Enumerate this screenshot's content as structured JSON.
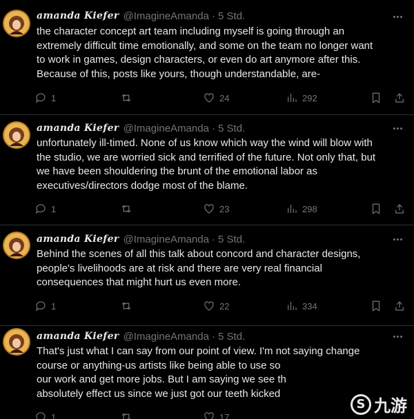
{
  "tweets": [
    {
      "name": "amanda Kiefer",
      "handle": "@ImagineAmanda",
      "sep": "·",
      "time": "5 Std.",
      "lines": [
        "the character concept art team including myself is going through an",
        "extremely difficult time emotionally, and some on the team no longer want",
        "to work in games, design characters, or even do art anymore after this.",
        "Because of this, posts like yours, though understandable, are-"
      ],
      "replies": "1",
      "retweets": "",
      "likes": "24",
      "views": "292"
    },
    {
      "name": "amanda Kiefer",
      "handle": "@ImagineAmanda",
      "sep": "·",
      "time": "5 Std.",
      "lines": [
        "unfortunately ill-timed.  None of us know which way the wind will blow with",
        "the studio, we are worried sick and terrified of the future.  Not only that, but",
        "we have been shouldering the brunt of the emotional labor as",
        "executives/directors dodge most of the blame."
      ],
      "replies": "1",
      "retweets": "",
      "likes": "23",
      "views": "298"
    },
    {
      "name": "amanda Kiefer",
      "handle": "@ImagineAmanda",
      "sep": "·",
      "time": "5 Std.",
      "lines": [
        "Behind the scenes of all this talk about concord and character designs,",
        "people's livelihoods are at risk and there are very real financial",
        "consequences that might hurt us even more."
      ],
      "replies": "1",
      "retweets": "",
      "likes": "22",
      "views": "334"
    },
    {
      "name": "amanda Kiefer",
      "handle": "@ImagineAmanda",
      "sep": "·",
      "time": "5 Std.",
      "lines": [
        "That's just what I can say from our point of view.  I'm not saying change",
        "course or anything-us artists like being able to use so",
        "our work and get more jobs.  But I am saying we see th",
        "absolutely effect us since we just got our teeth kicked"
      ],
      "replies": "1",
      "retweets": "",
      "likes": "17",
      "views": ""
    }
  ],
  "watermark": {
    "glyph": "S",
    "text": "九游"
  }
}
